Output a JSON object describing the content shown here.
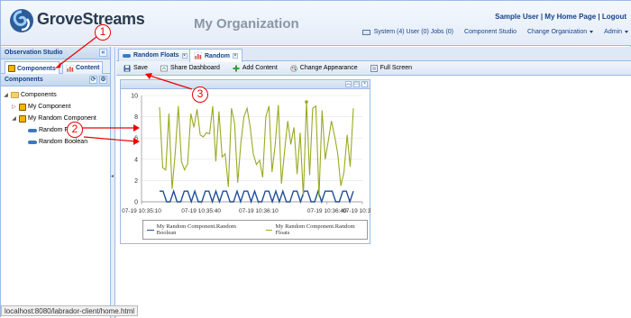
{
  "header": {
    "logo_text": "GroveStreams",
    "org_title": "My Organization",
    "user_links": [
      "Sample User",
      "My Home Page",
      "Logout"
    ],
    "status": "System (4) User (0) Jobs (0)",
    "menu": [
      "Component Studio",
      "Change Organization",
      "Admin"
    ]
  },
  "left": {
    "studio_title": "Observation Studio",
    "tabs": [
      "Components",
      "Content"
    ],
    "components_title": "Components",
    "tree": [
      {
        "label": "Components",
        "level": 0,
        "type": "folder"
      },
      {
        "label": "My Component",
        "level": 1,
        "type": "component"
      },
      {
        "label": "My Random Component",
        "level": 1,
        "type": "component"
      },
      {
        "label": "Random Floats",
        "level": 2,
        "type": "stream"
      },
      {
        "label": "Random Boolean",
        "level": 2,
        "type": "stream"
      }
    ]
  },
  "main": {
    "tabs": [
      "Random Floats",
      "Random"
    ],
    "toolbar": [
      "Save",
      "Share Dashboard",
      "Add Content",
      "Change Appearance",
      "Full Screen"
    ]
  },
  "annotations": [
    "1",
    "2",
    "3"
  ],
  "status_url": "localhost:8080/labrador-client/home.html",
  "colors": {
    "floats": "#99aa22",
    "boolean": "#1f4e99",
    "accent": "#15428b"
  },
  "chart_data": {
    "type": "line",
    "x_ticks": [
      "07-19 10:35:10",
      "07-19 10:35:40",
      "07-19 10:36:10",
      "07-19 10:36:40",
      "07-19 10:37:00"
    ],
    "ylim": [
      0,
      10
    ],
    "y_ticks": [
      "0",
      "2",
      "4",
      "6",
      "8",
      "10"
    ],
    "grid": true,
    "legend_position": "bottom",
    "series": [
      {
        "name": "My Random Component.Random Boolean",
        "values": [
          1,
          1,
          0,
          0,
          1,
          0,
          0,
          1,
          1,
          0,
          1,
          0,
          0,
          1,
          1,
          0,
          1,
          0,
          1,
          1,
          0,
          0,
          1,
          0,
          1,
          1,
          0,
          1,
          0,
          0,
          1,
          1,
          0,
          1,
          0,
          1,
          0,
          0,
          1,
          1,
          0,
          1,
          1,
          0,
          0,
          1,
          0,
          1,
          1,
          1,
          0,
          0,
          1,
          1,
          0,
          1
        ]
      },
      {
        "name": "My Random Component.Random Floats",
        "values": [
          8.9,
          3.2,
          3.0,
          8.3,
          1.2,
          4.5,
          9.0,
          3.8,
          3.0,
          3.6,
          8.3,
          7.0,
          8.7,
          6.3,
          6.1,
          6.5,
          6.4,
          9.0,
          3.8,
          8.5,
          4.2,
          4.5,
          1.4,
          8.8,
          7.4,
          1.8,
          5.5,
          8.0,
          8.8,
          7.0,
          4.5,
          3.5,
          3.9,
          2.3,
          8.0,
          9.0,
          2.8,
          5.4,
          9.1,
          1.7,
          4.8,
          7.6,
          5.4,
          7.0,
          2.6,
          6.5,
          0.5,
          9.4,
          2.5,
          8.8,
          9.0,
          0.5,
          8.6,
          4.0,
          5.8,
          7.6,
          6.2,
          4.5,
          1.5,
          2.8,
          6.3,
          3.3,
          8.8
        ]
      }
    ]
  }
}
